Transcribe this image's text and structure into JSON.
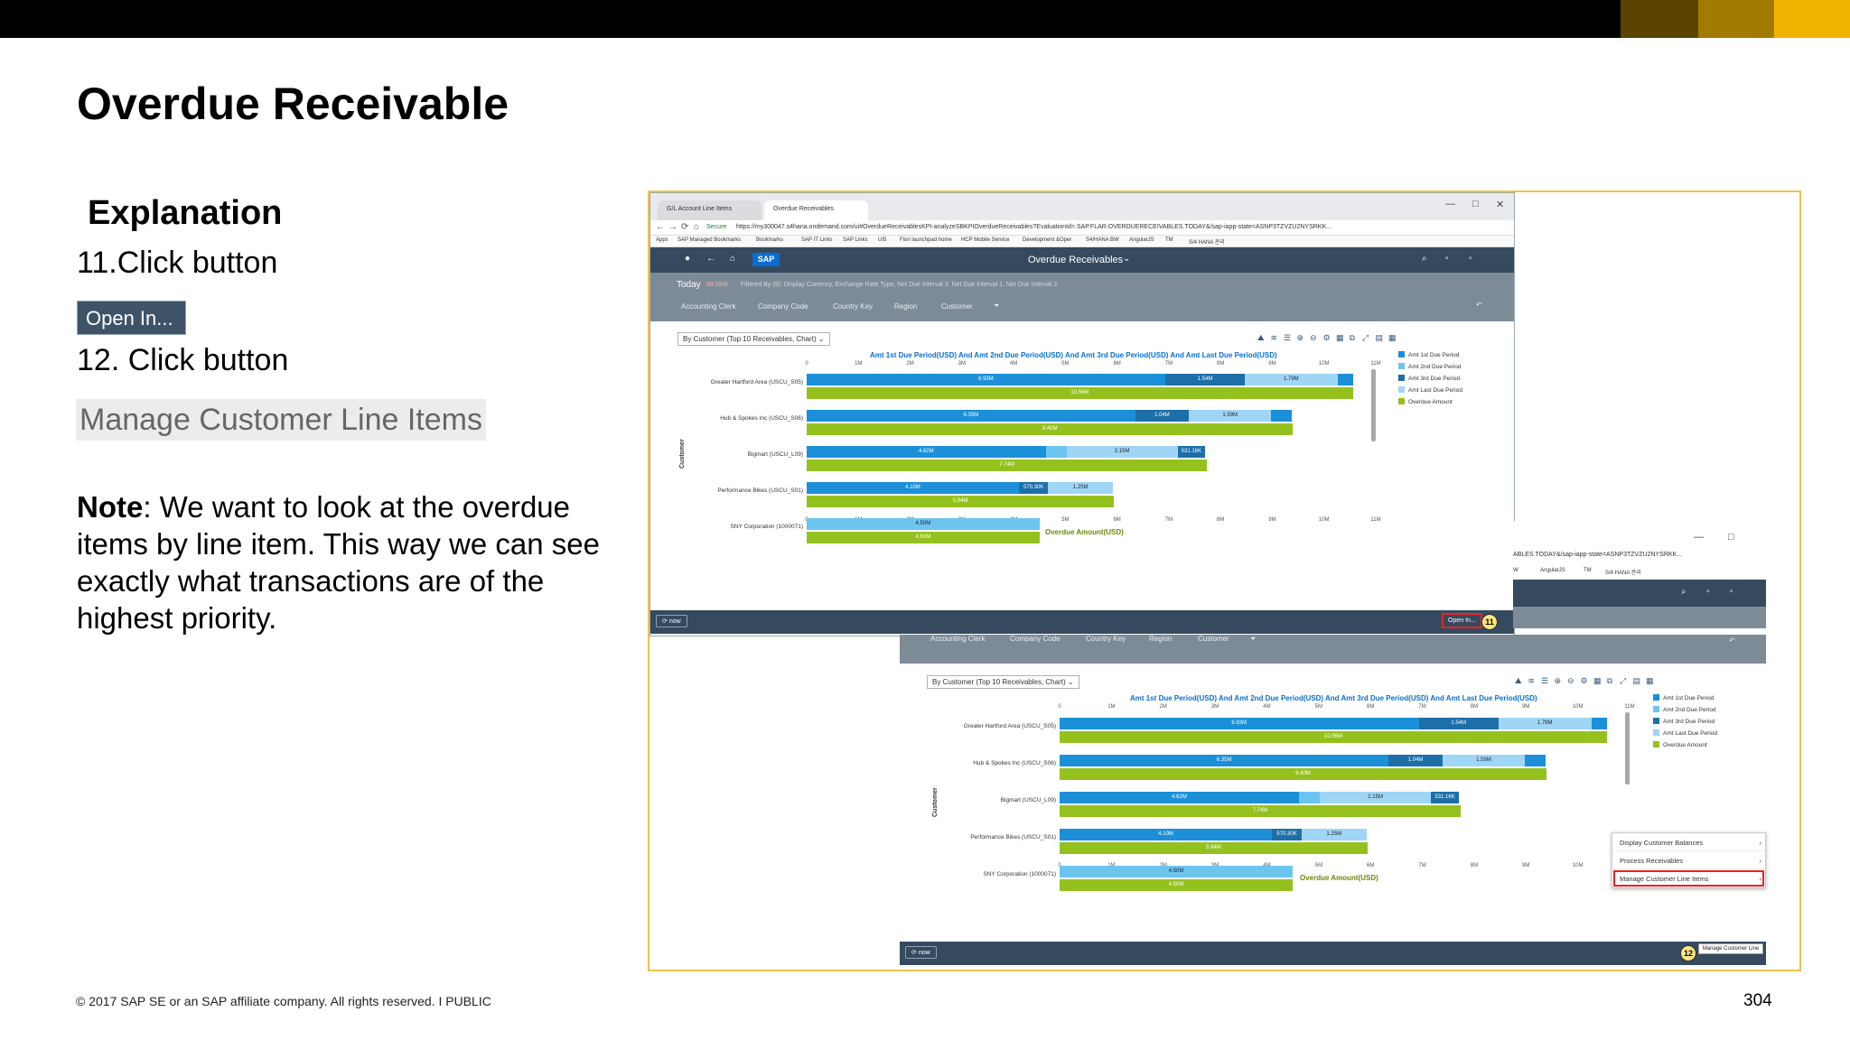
{
  "slide": {
    "title": "Overdue Receivable",
    "explanation_heading": "Explanation",
    "step11": "11.Click button",
    "open_in_sample": "Open In...",
    "step12": "12. Click button",
    "manage_sample": "Manage Customer Line Items",
    "note_label": "Note",
    "note_text": ":  We want to look at the overdue items by line item. This way we can see exactly what transactions are of the highest priority.",
    "footer": "© 2017 SAP SE or an SAP affiliate company. All rights reserved.  I   PUBLIC",
    "page_number": "304",
    "corner_colors": [
      "#5a4400",
      "#a27a00",
      "#f0b400"
    ]
  },
  "browser": {
    "tabs": [
      "G/L Account Line Items",
      "Overdue Receivables"
    ],
    "url": "https://my300047.s4hana.ondemand.com/ui#OverdueReceivablesKPI-analyzeSBKPIOverdueReceivables?EvaluationId=.SAP.FLAR.OVERDUERECEIVABLES.TODAY&/sap-iapp-state=ASNP3TZVZU2NYSRKK...",
    "secure_label": "Secure",
    "window_controls": [
      "—",
      "□",
      "✕"
    ],
    "bookmarks": [
      "Apps",
      "SAP Managed Bookmarks",
      "Bookmarks",
      "SAP IT Links",
      "SAP Links",
      "UI5",
      "Fiori launchpad home",
      "HCP Mobile Service",
      "Development &Oper",
      "S4/HANA BW",
      "AngularJS",
      "TM",
      "S/4 HANA 관리"
    ],
    "url2": "ABLES.TODAY&/sap-iapp-state=ASNP3TZVZU2NYSRKK...",
    "bookmarks2": [
      "W",
      "AngularJS",
      "TM",
      "S/4 HANA 관리"
    ]
  },
  "app": {
    "logo": "SAP",
    "title": "Overdue Receivables",
    "today": "Today",
    "percent": "99.55%",
    "filtered_by": "Filtered By (9): Display Currency, Exchange Rate Type, Net Due Interval 3, Net Due Interval 1, Net Due Interval 2",
    "filters": [
      "Accounting Clerk",
      "Company Code",
      "Country Key",
      "Region",
      "Customer"
    ],
    "view_select": "By Customer (Top 10 Receivables, Chart)",
    "now": "now",
    "open_in": "Open In...",
    "menu_items": [
      "Display Customer Balances",
      "Process Receivables",
      "Manage Customer Line Items"
    ],
    "manage_tooltip": "Manage Customer Line",
    "callouts": [
      "11",
      "12"
    ]
  },
  "chart_data": {
    "type": "bar",
    "title": "Amt 1st Due Period(USD) And Amt 2nd Due Period(USD) And Amt 3rd Due Period(USD) And Amt Last Due Period(USD)",
    "xlabel": "Overdue Amount(USD)",
    "ylabel": "Customer",
    "xlim": [
      0,
      11
    ],
    "x_unit": "M",
    "ticks": [
      "0",
      "1M",
      "2M",
      "3M",
      "4M",
      "5M",
      "6M",
      "7M",
      "8M",
      "9M",
      "10M",
      "11M"
    ],
    "categories": [
      "Greater Hartford Area (USCU_S05)",
      "Hub & Spokes Inc (USCU_S06)",
      "Bigmart (USCU_L09)",
      "Performance Bikes (USCU_S01)",
      "SNY Corporation (1000071)"
    ],
    "stacked_series": [
      {
        "name": "Amt 1st Due Period",
        "color": "#1b90d8",
        "values": [
          6.93,
          6.35,
          4.62,
          4.1,
          0
        ],
        "labels": [
          "6.93M",
          "6.35M",
          "4.62M",
          "4.10M",
          ""
        ]
      },
      {
        "name": "Amt 2nd Due Period",
        "color": "#6cc5ef",
        "values": [
          0,
          0,
          0.4,
          0,
          4.5
        ],
        "labels": [
          "",
          "",
          "",
          "",
          "4.50M"
        ]
      },
      {
        "name": "Amt 3rd Due Period",
        "color": "#1d6fa8",
        "values": [
          1.54,
          1.04,
          0,
          0.5703,
          0
        ],
        "labels": [
          "1.54M",
          "1.04M",
          "",
          "570.30K",
          ""
        ]
      },
      {
        "name": "Amt Last Due Period",
        "color": "#9fd6f5",
        "values": [
          1.79,
          1.59,
          2.15,
          1.25,
          0
        ],
        "labels": [
          "1.79M",
          "1.59M",
          "2.15M",
          "1.25M",
          ""
        ]
      },
      {
        "name": "Amt 1st Due Period",
        "color": "#1b90d8",
        "values": [
          0.3,
          0.4,
          0,
          0,
          0
        ],
        "labels": [
          "",
          "",
          "",
          "",
          ""
        ]
      },
      {
        "name": "Amt 3rd Due Period",
        "color": "#1d6fa8",
        "values": [
          0,
          0,
          0.53116,
          0,
          0
        ],
        "labels": [
          "",
          "",
          "531.16K",
          "",
          ""
        ]
      }
    ],
    "legend": [
      {
        "name": "Amt 1st Due Period",
        "color": "#1b90d8"
      },
      {
        "name": "Amt 2nd Due Period",
        "color": "#6cc5ef"
      },
      {
        "name": "Amt 3rd Due Period",
        "color": "#1d6fa8"
      },
      {
        "name": "Amt Last Due Period",
        "color": "#9fd6f5"
      },
      {
        "name": "Overdue Amount",
        "color": "#95c11f"
      }
    ],
    "overdue_series": {
      "name": "Overdue Amount",
      "color": "#95c11f",
      "values": [
        10.56,
        9.4,
        7.74,
        5.94,
        4.5
      ],
      "labels": [
        "10.56M",
        "9.40M",
        "7.74M",
        "5.94M",
        "4.50M"
      ]
    },
    "legend_position": "right"
  }
}
